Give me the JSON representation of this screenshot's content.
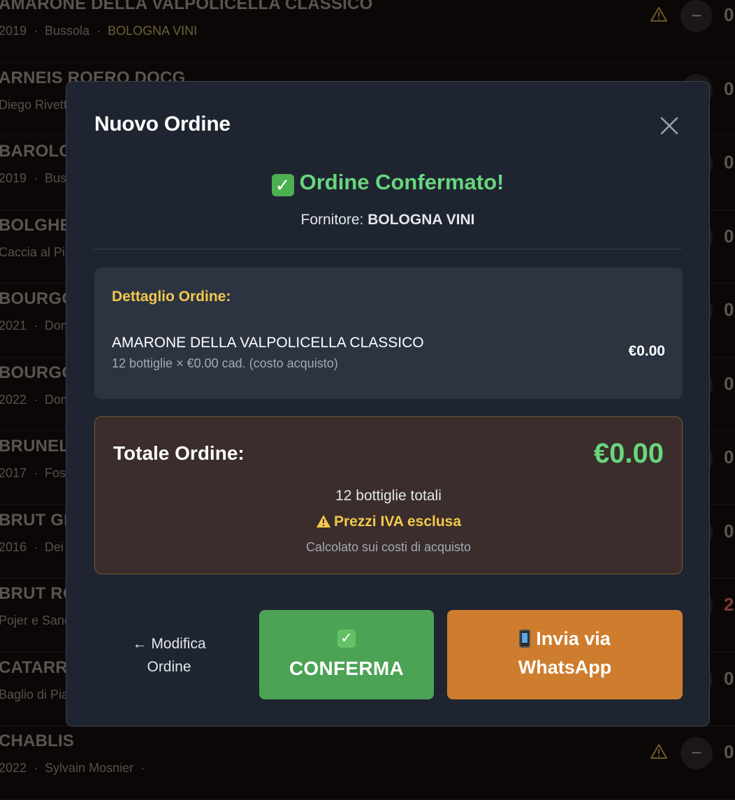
{
  "background_list": [
    {
      "name": "AMARONE DELLA VALPOLICELLA CLASSICO",
      "meta": [
        "2019",
        "Bussola",
        "BOLOGNA VINI"
      ],
      "qty": "0",
      "warning": true,
      "qty_red": false
    },
    {
      "name": "ARNEIS ROERO DOCG",
      "meta": [
        "Diego Rivetti"
      ],
      "qty": "0",
      "warning": false,
      "qty_red": false
    },
    {
      "name": "BAROLO",
      "meta": [
        "2019",
        "Bussola"
      ],
      "qty": "0",
      "warning": false,
      "qty_red": false
    },
    {
      "name": "BOLGHERI",
      "meta": [
        "Caccia al Piano"
      ],
      "qty": "0",
      "warning": false,
      "qty_red": false
    },
    {
      "name": "BOURGOGNE",
      "meta": [
        "2021",
        "Domaine"
      ],
      "qty": "0",
      "warning": false,
      "qty_red": false
    },
    {
      "name": "BOURGOGNE",
      "meta": [
        "2022",
        "Domaine"
      ],
      "qty": "0",
      "warning": false,
      "qty_red": false
    },
    {
      "name": "BRUNELLO",
      "meta": [
        "2017",
        "Fossacolle"
      ],
      "qty": "0",
      "warning": false,
      "qty_red": false
    },
    {
      "name": "BRUT GRAN",
      "meta": [
        "2016",
        "Dei"
      ],
      "qty": "0",
      "warning": false,
      "qty_red": false
    },
    {
      "name": "BRUT ROSE",
      "meta": [
        "Pojer e Sandri"
      ],
      "qty": "2",
      "warning": false,
      "qty_red": true
    },
    {
      "name": "CATARRATTO",
      "meta": [
        "Baglio di Pianetto"
      ],
      "qty": "0",
      "warning": false,
      "qty_red": false
    },
    {
      "name": "CHABLIS",
      "meta": [
        "2022",
        "Sylvain Mosnier",
        ""
      ],
      "qty": "0",
      "warning": true,
      "qty_red": false
    }
  ],
  "modal": {
    "title": "Nuovo Ordine",
    "success_icon": "✓",
    "success_text": "Ordine Confermato!",
    "supplier_label": "Fornitore:",
    "supplier_name": "BOLOGNA VINI",
    "detail_title": "Dettaglio Ordine:",
    "item": {
      "name": "AMARONE DELLA VALPOLICELLA CLASSICO",
      "detail": "12 bottiglie × €0.00 cad. (costo acquisto)",
      "price": "€0.00"
    },
    "total_label": "Totale Ordine:",
    "total_value": "€0.00",
    "bottles_total": "12 bottiglie totali",
    "vat_note": "Prezzi IVA esclusa",
    "calc_note": "Calcolato sui costi di acquisto",
    "back_line1": "← Modifica",
    "back_line2": "Ordine",
    "confirm_icon": "✓",
    "confirm_label": "CONFERMA",
    "whatsapp_line1": "Invia via",
    "whatsapp_line2": "WhatsApp"
  },
  "colors": {
    "modal_bg": "#1e2531",
    "success_green": "#68d67c",
    "accent_yellow": "#f2c94c",
    "confirm_green": "#4ca355",
    "whatsapp_orange": "#cd7d2d"
  }
}
